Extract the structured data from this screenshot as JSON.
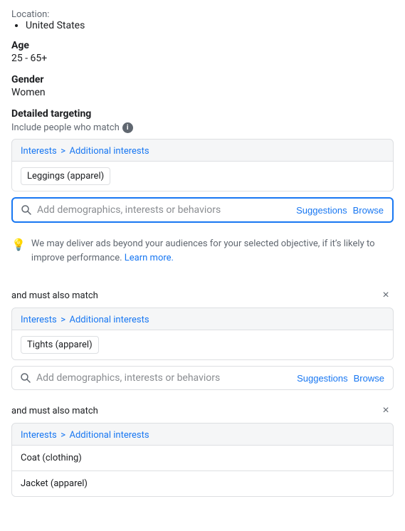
{
  "location": {
    "label": "Location:",
    "values": [
      "United States"
    ]
  },
  "age": {
    "label": "Age",
    "value": "25 - 65+"
  },
  "gender": {
    "label": "Gender",
    "value": "Women"
  },
  "detailed_targeting": {
    "label": "Detailed targeting",
    "include_label": "Include people who match",
    "info_icon": "i"
  },
  "block1": {
    "breadcrumb_interest": "Interests",
    "breadcrumb_sep": ">",
    "breadcrumb_additional": "Additional interests",
    "tag": "Leggings (apparel)",
    "search_placeholder": "Add demographics, interests or behaviors",
    "suggestions_btn": "Suggestions",
    "browse_btn": "Browse"
  },
  "tip": {
    "text": "We may deliver ads beyond your audiences for your selected objective, if it’s likely to improve performance.",
    "link_text": "Learn more."
  },
  "and_must_1": {
    "label": "and must also match",
    "breadcrumb_interest": "Interests",
    "breadcrumb_sep": ">",
    "breadcrumb_additional": "Additional interests",
    "tag": "Tights (apparel)",
    "search_placeholder": "Add demographics, interests or behaviors",
    "suggestions_btn": "Suggestions",
    "browse_btn": "Browse",
    "close_icon": "×"
  },
  "and_must_2": {
    "label": "and must also match",
    "breadcrumb_interest": "Interests",
    "breadcrumb_sep": ">",
    "breadcrumb_additional": "Additional interests",
    "tags": [
      "Coat (clothing)",
      "Jacket (apparel)"
    ],
    "close_icon": "×"
  }
}
